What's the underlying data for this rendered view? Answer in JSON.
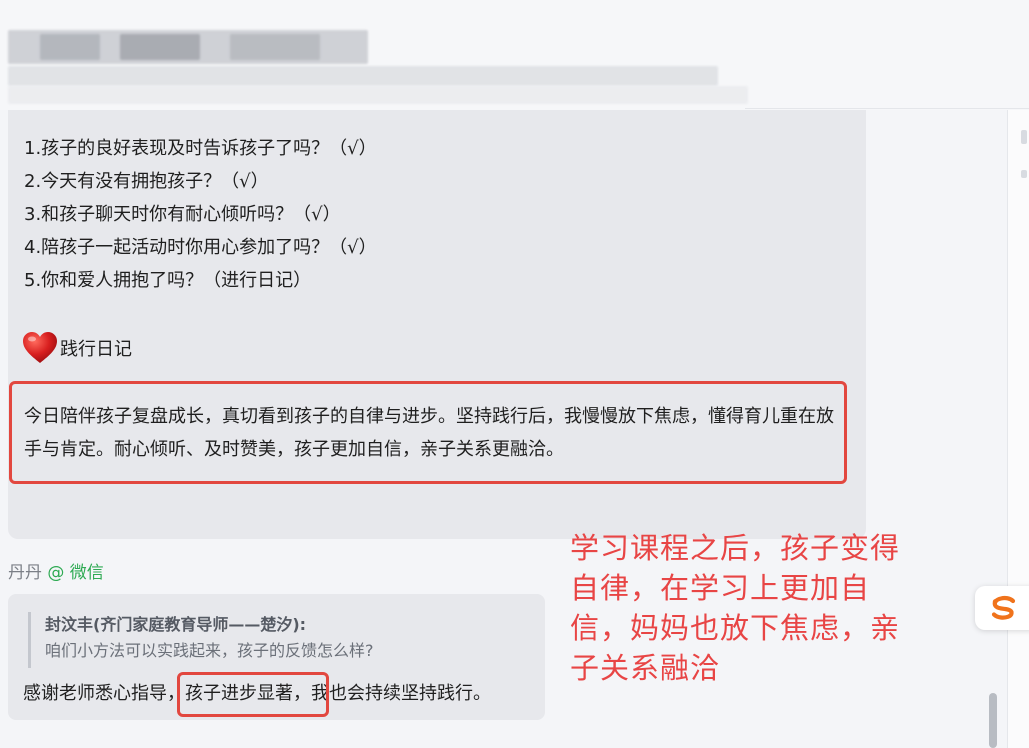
{
  "checklist": [
    "1.孩子的良好表现及时告诉孩子了吗？（√）",
    "2.今天有没有拥抱孩子？（√）",
    "3.和孩子聊天时你有耐心倾听吗？（√）",
    "4.陪孩子一起活动时你用心参加了吗？（√）",
    "5.你和爱人拥抱了吗？（进行日记）"
  ],
  "diary": {
    "heading": "践行日记",
    "icon": "heart-icon",
    "text": "今日陪伴孩子复盘成长，真切看到孩子的自律与进步。坚持践行后，我慢慢放下焦虑，懂得育儿重在放手与肯定。耐心倾听、及时赞美，孩子更加自信，亲子关系更融洽。"
  },
  "sender": {
    "name": "丹丹",
    "platform": "@ 微信"
  },
  "reply": {
    "quote_author": "封汶丰(齐门家庭教育导师——楚汐):",
    "quote_text": "咱们小方法可以实践起来，孩子的反馈怎么样?",
    "text_before": "感谢老师悉心指导，",
    "text_highlight": "孩子进步显著，",
    "text_after": "我也会持续坚持践行。"
  },
  "annotation": "学习课程之后，孩子变得自律，在学习上更加自信，妈妈也放下焦虑，亲子关系融洽",
  "float_button": {
    "icon": "s-logo-icon",
    "label": "S"
  },
  "colors": {
    "accent_red": "#e2473f",
    "annotation_red": "#e84545",
    "platform_green": "#2eaa53",
    "bubble_bg": "#e7e8ec",
    "float_orange": "#f0731c"
  }
}
